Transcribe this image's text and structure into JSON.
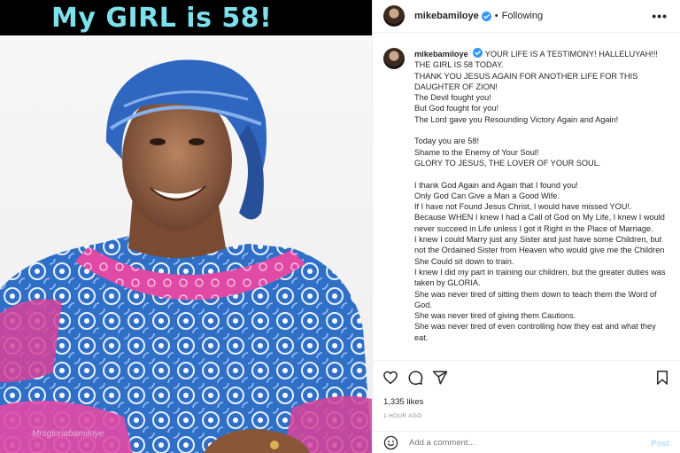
{
  "media": {
    "banner_text": "My GIRL is 58!",
    "watermark": "Mrsgloriabamiloye"
  },
  "header": {
    "username": "mikebamiloye",
    "separator": "•",
    "follow_status": "Following",
    "more_glyph": "•••"
  },
  "caption": {
    "username": "mikebamiloye",
    "lines": [
      "YOUR LIFE IS A TESTIMONY! HALLELUYAH!!!",
      "THE GIRL IS 58 TODAY.",
      "THANK YOU JESUS AGAIN FOR ANOTHER LIFE FOR THIS DAUGHTER OF ZION!",
      "The Devil fought you!",
      "But God fought for you!",
      "The Lord gave you Resounding Victory Again and Again!",
      "",
      "Today you are 58!",
      "Shame to the Enemy of Your Soul!",
      "GLORY TO JESUS, THE LOVER OF YOUR SOUL.",
      "",
      "I thank God Again and Again that I found you!",
      "Only God Can Give a Man a Good Wife.",
      "If I have not Found Jesus Christ, I would have missed YOU!.",
      "Because WHEN I knew I had a Call of God on My Life, I knew I would never succeed in Life unless I got it Right in the Place of Marriage.",
      "I knew I could Marry just any Sister and just have some Children, but not the Ordained Sister from Heaven who would give me the Children She Could sit down to train.",
      "I knew I did my part in training our children, but the greater duties was taken by GLORIA.",
      "She was never tired of sitting them down to teach them the Word of God.",
      "She was never tired of giving them Cautions.",
      "She was never tired of even controlling how they eat and what they eat."
    ]
  },
  "actions": {
    "likes": "1,335 likes",
    "time": "1 HOUR AGO"
  },
  "comment": {
    "placeholder": "Add a comment...",
    "post_label": "Post"
  },
  "colors": {
    "verified": "#3897f0",
    "banner_text": "#7ee0ea",
    "post_disabled": "#b2dffc"
  }
}
